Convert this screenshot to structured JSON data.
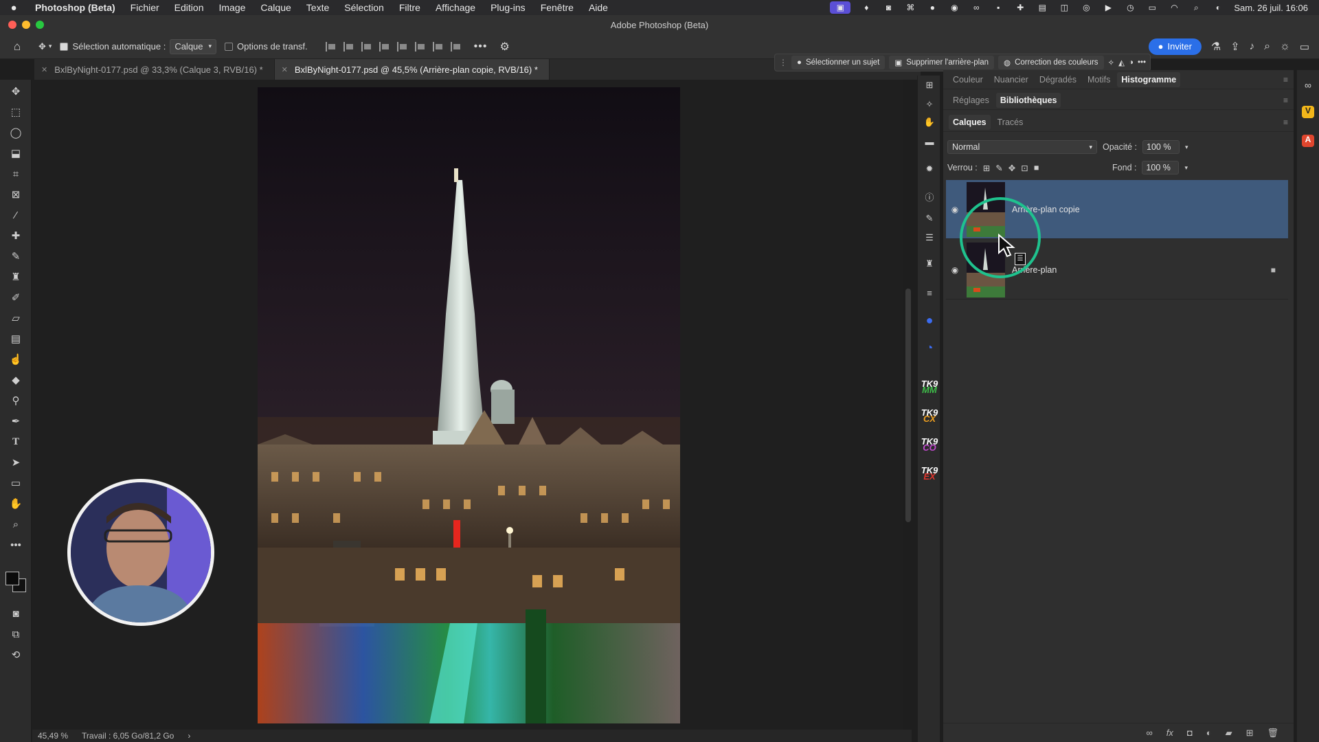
{
  "menubar": {
    "app_name": "Photoshop (Beta)",
    "items": [
      "Fichier",
      "Edition",
      "Image",
      "Calque",
      "Texte",
      "Sélection",
      "Filtre",
      "Affichage",
      "Plug-ins",
      "Fenêtre",
      "Aide"
    ],
    "clock": "Sam. 26 juil.  16:06"
  },
  "window": {
    "title": "Adobe Photoshop (Beta)"
  },
  "options_bar": {
    "auto_select_label": "Sélection automatique :",
    "auto_select_checked": true,
    "auto_select_target": "Calque",
    "transform_options_label": "Options de transf.",
    "invite_label": "Inviter"
  },
  "doc_tabs": [
    {
      "label": "BxlByNight-0177.psd @ 33,3% (Calque 3, RVB/16) *",
      "active": false
    },
    {
      "label": "BxlByNight-0177.psd @ 45,5% (Arrière-plan copie, RVB/16) *",
      "active": true
    }
  ],
  "contextual_bar": {
    "select_subject": "Sélectionner un sujet",
    "remove_background": "Supprimer l'arrière-plan",
    "color_correction": "Correction des couleurs"
  },
  "panels": {
    "row1_tabs": [
      "Couleur",
      "Nuancier",
      "Dégradés",
      "Motifs",
      "Histogramme"
    ],
    "row1_active": "Histogramme",
    "row2_tabs": [
      "Réglages",
      "Bibliothèques"
    ],
    "row2_active": "Bibliothèques",
    "row3_tabs": [
      "Calques",
      "Tracés"
    ],
    "row3_active": "Calques"
  },
  "layers_panel": {
    "blend_mode": "Normal",
    "opacity_label": "Opacité :",
    "opacity_value": "100 %",
    "lock_label": "Verrou :",
    "fill_label": "Fond :",
    "fill_value": "100 %",
    "layers": [
      {
        "name": "Arrière-plan copie",
        "visible": true,
        "selected": true,
        "locked": false
      },
      {
        "name": "Arrière-plan",
        "visible": true,
        "selected": false,
        "locked": true
      }
    ]
  },
  "status_bar": {
    "zoom": "45,49 %",
    "scratch": "Travail : 6,05 Go/81,2 Go"
  },
  "plugin_icons": [
    {
      "top": "TK9",
      "bottom": "MM"
    },
    {
      "top": "TK9",
      "bottom": "CX"
    },
    {
      "top": "TK9",
      "bottom": "CO"
    },
    {
      "top": "TK9",
      "bottom": "EX"
    }
  ],
  "colors": {
    "accent_blue": "#2b6fe8",
    "layer_selected": "#3f5a7c",
    "highlight_ring": "#1fc28e"
  }
}
